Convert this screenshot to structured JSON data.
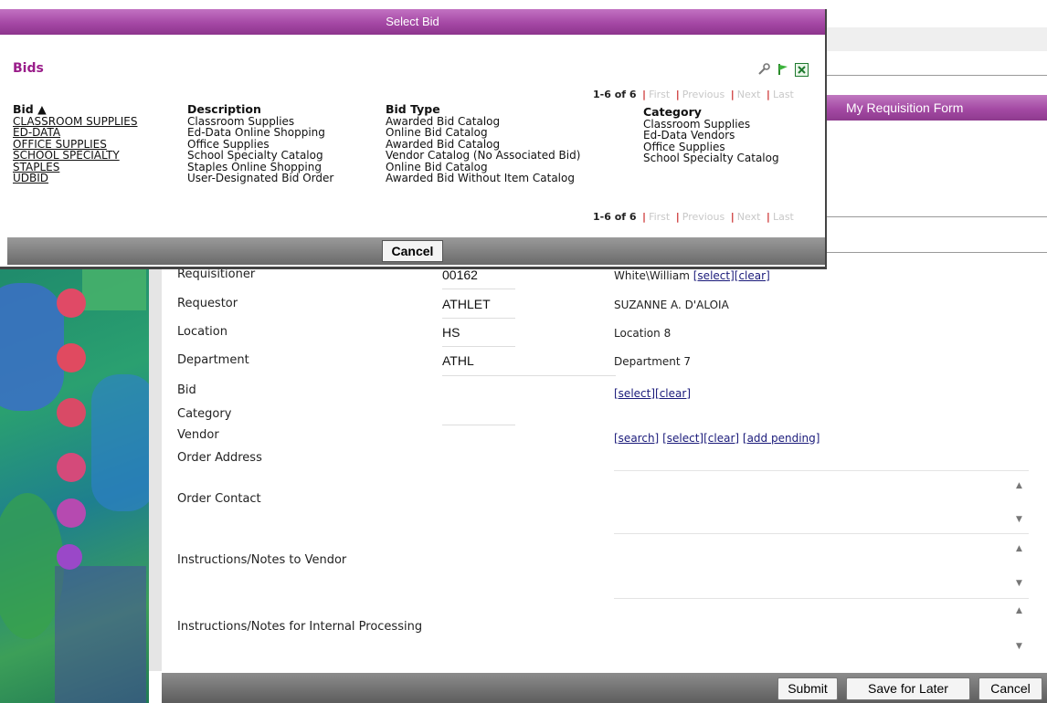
{
  "dialog": {
    "title": "Select Bid",
    "heading": "Bids",
    "pager": {
      "count": "1-6 of 6",
      "first": "First",
      "previous": "Previous",
      "next": "Next",
      "last": "Last"
    },
    "columns": {
      "bid": "Bid ▲",
      "description": "Description",
      "bid_type": "Bid Type",
      "category": "Category"
    },
    "bids": [
      "CLASSROOM SUPPLIES",
      "ED-DATA",
      "OFFICE SUPPLIES",
      "SCHOOL SPECIALTY",
      "STAPLES",
      "UDBID"
    ],
    "descriptions": [
      "Classroom Supplies",
      "Ed-Data Online Shopping",
      "Office Supplies",
      "School Specialty Catalog",
      "Staples Online Shopping",
      "User-Designated Bid Order"
    ],
    "bid_types": [
      "Awarded Bid Catalog",
      "Online Bid Catalog",
      "Awarded Bid Catalog",
      "Vendor Catalog (No Associated Bid)",
      "Online Bid Catalog",
      "Awarded Bid Without Item Catalog"
    ],
    "categories": [
      "Classroom Supplies",
      "Ed-Data Vendors",
      "Office Supplies",
      "School Specialty Catalog"
    ],
    "cancel": "Cancel",
    "icons": [
      "wrench-icon",
      "green-flag-icon",
      "excel-icon"
    ]
  },
  "page": {
    "form_title": "My Requisition Form",
    "fields": {
      "requisitioner": {
        "label": "Requisitioner",
        "code": "00162",
        "value": "White\\William",
        "select": "[select]",
        "clear": "[clear]"
      },
      "requestor": {
        "label": "Requestor",
        "code": "ATHLET",
        "value": "SUZANNE A. D'ALOIA"
      },
      "location": {
        "label": "Location",
        "code": "HS",
        "value": "Location 8"
      },
      "department": {
        "label": "Department",
        "code": "ATHL",
        "value": "Department 7"
      },
      "bid": {
        "label": "Bid",
        "select": "[select]",
        "clear": "[clear]"
      },
      "category": {
        "label": "Category"
      },
      "vendor": {
        "label": "Vendor",
        "search": "[search]",
        "select": "[select]",
        "clear": "[clear]",
        "add_pending": "[add pending]"
      },
      "order_address": {
        "label": "Order Address"
      },
      "order_contact": {
        "label": "Order Contact"
      },
      "notes_vendor": {
        "label": "Instructions/Notes to Vendor"
      },
      "notes_internal": {
        "label": "Instructions/Notes for Internal Processing"
      }
    },
    "buttons": {
      "submit": "Submit",
      "save_later": "Save for Later",
      "cancel": "Cancel"
    }
  },
  "colors": {
    "title_bar": "#a548a5",
    "heading": "#9a1d8a",
    "pager_sep": "#cc3333"
  }
}
